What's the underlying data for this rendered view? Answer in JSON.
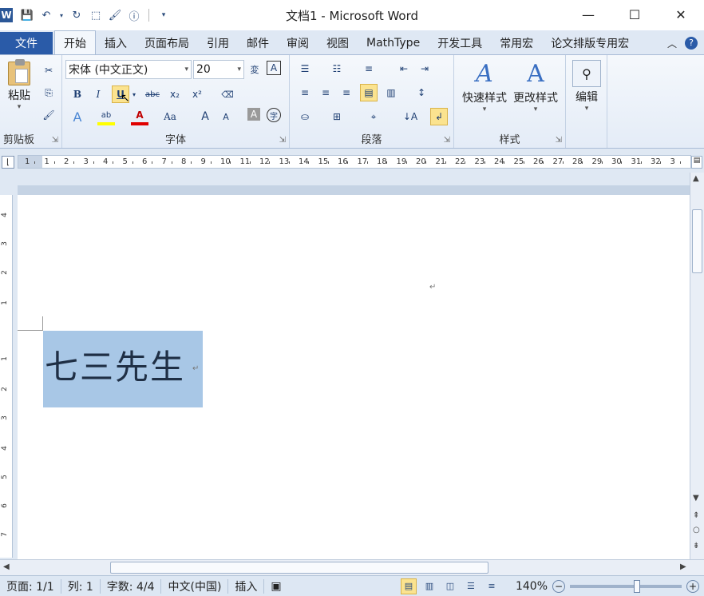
{
  "window": {
    "title": "文档1 - Microsoft Word",
    "app_icon": "W",
    "controls": [
      "minimize-icon",
      "maximize-icon",
      "close-icon"
    ]
  },
  "qat": [
    "save-icon",
    "undo-icon",
    "redo-icon",
    "customize-icon"
  ],
  "tabs": {
    "file": "文件",
    "items": [
      "开始",
      "插入",
      "页面布局",
      "引用",
      "邮件",
      "审阅",
      "视图",
      "MathType",
      "开发工具",
      "常用宏",
      "论文排版专用宏"
    ],
    "active": "开始"
  },
  "ribbon": {
    "clipboard": {
      "paste": "粘贴",
      "label": "剪贴板"
    },
    "font": {
      "font_name": "宋体 (中文正文)",
      "font_size": "20",
      "label": "字体",
      "bold": "B",
      "italic": "I",
      "underline": "U",
      "strike": "abc",
      "subscript": "x₂",
      "superscript": "x²",
      "grow": "A",
      "shrink": "A",
      "change_case": "Aa"
    },
    "paragraph": {
      "label": "段落"
    },
    "styles": {
      "quick_styles": "快速样式",
      "change_styles": "更改样式",
      "label": "样式"
    },
    "editing": {
      "label": "编辑"
    },
    "accent_color": "#2a5ba8",
    "highlight_color": "#fbe38f"
  },
  "ruler": {
    "h_ticks": [
      "1",
      "1",
      "2",
      "3",
      "4",
      "5",
      "6",
      "7",
      "8",
      "9",
      "10",
      "11",
      "12",
      "13",
      "14",
      "15",
      "16",
      "17",
      "18",
      "19",
      "20",
      "21",
      "22",
      "23",
      "24",
      "25",
      "26",
      "27",
      "28",
      "29",
      "30",
      "31",
      "32",
      "3"
    ],
    "v_ticks": [
      "4",
      "3",
      "2",
      "1",
      "1",
      "2",
      "3",
      "4",
      "5",
      "6",
      "7"
    ]
  },
  "document": {
    "text": "七三先生",
    "para_mark": "↵",
    "selection_color": "#a8c7e6"
  },
  "status": {
    "page": "页面: 1/1",
    "column": "列: 1",
    "word_count": "字数: 4/4",
    "language": "中文(中国)",
    "mode": "插入",
    "zoom": "140%"
  }
}
